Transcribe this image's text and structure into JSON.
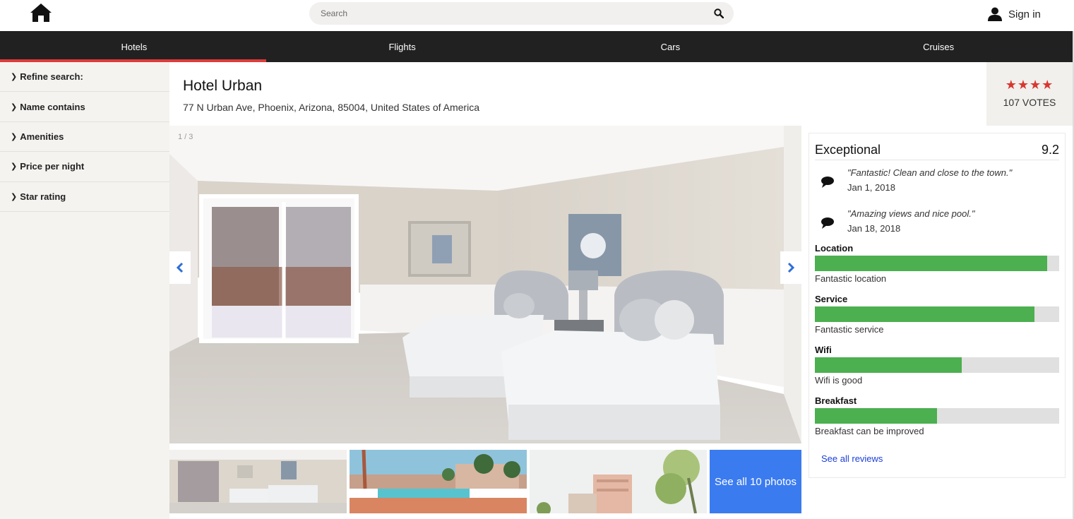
{
  "header": {
    "search": {
      "placeholder": "Search"
    },
    "signin_label": "Sign in"
  },
  "nav": {
    "tabs": [
      {
        "label": "Hotels",
        "active": true
      },
      {
        "label": "Flights",
        "active": false
      },
      {
        "label": "Cars",
        "active": false
      },
      {
        "label": "Cruises",
        "active": false
      }
    ]
  },
  "sidebar": {
    "items": [
      {
        "label": "Refine search:"
      },
      {
        "label": "Name contains"
      },
      {
        "label": "Amenities"
      },
      {
        "label": "Price per night"
      },
      {
        "label": "Star rating"
      }
    ]
  },
  "hotel": {
    "name": "Hotel Urban",
    "address": "77 N Urban Ave, Phoenix, Arizona, 85004, United States of America",
    "stars": 4,
    "stars_display": "★★★★",
    "votes": "107 VOTES"
  },
  "gallery": {
    "counter": "1 / 3",
    "see_all_label": "See all 10 photos"
  },
  "reviews": {
    "rating_label": "Exceptional",
    "score": "9.2",
    "quotes": [
      {
        "text": "\"Fantastic! Clean and close to the town.\"",
        "date": "Jan 1, 2018"
      },
      {
        "text": "\"Amazing views and nice pool.\"",
        "date": "Jan 18, 2018"
      }
    ],
    "metrics": [
      {
        "label": "Location",
        "description": "Fantastic location",
        "level": 0.95
      },
      {
        "label": "Service",
        "description": "Fantastic service",
        "level": 0.9
      },
      {
        "label": "Wifi",
        "description": "Wifi is good",
        "level": 0.6
      },
      {
        "label": "Breakfast",
        "description": "Breakfast can be improved",
        "level": 0.5
      }
    ],
    "see_all_label": "See all reviews"
  },
  "colors": {
    "nav_bg": "#212121",
    "active_underline": "#e03a3a",
    "star": "#d9362f",
    "bar_fill": "#4caf50",
    "see_all_photos_bg": "#3b7bf0",
    "link": "#1a3fd6"
  },
  "icons": {
    "home": "home-icon",
    "search": "search-icon",
    "user": "user-icon",
    "quote": "speech-bubble-icon",
    "prev": "chevron-left-icon",
    "next": "chevron-right-icon",
    "sidebar": "chevron-right-icon"
  }
}
